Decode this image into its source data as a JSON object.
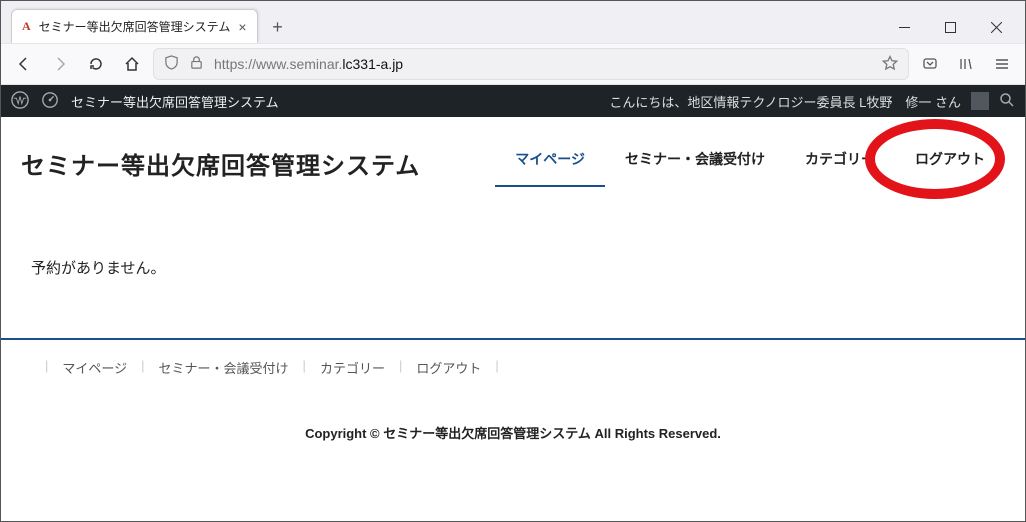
{
  "browser": {
    "tab_title": "セミナー等出欠席回答管理システム",
    "url_prefix": "https://www.seminar.",
    "url_bold": "lc331-a.jp"
  },
  "wpbar": {
    "site_name": "セミナー等出欠席回答管理システム",
    "greeting": "こんにちは、地区情報テクノロジー委員長 L牧野　修一 さん"
  },
  "header": {
    "title": "セミナー等出欠席回答管理システム",
    "nav": {
      "mypage": "マイページ",
      "seminar": "セミナー・会議受付け",
      "category": "カテゴリー",
      "logout": "ログアウト"
    }
  },
  "main": {
    "no_reservation": "予約がありません。"
  },
  "footer": {
    "nav": {
      "mypage": "マイページ",
      "seminar": "セミナー・会議受付け",
      "category": "カテゴリー",
      "logout": "ログアウト"
    },
    "copyright_prefix": "Copyright © ",
    "copyright_site": "セミナー等出欠席回答管理システム",
    "copyright_suffix": " All Rights Reserved."
  }
}
